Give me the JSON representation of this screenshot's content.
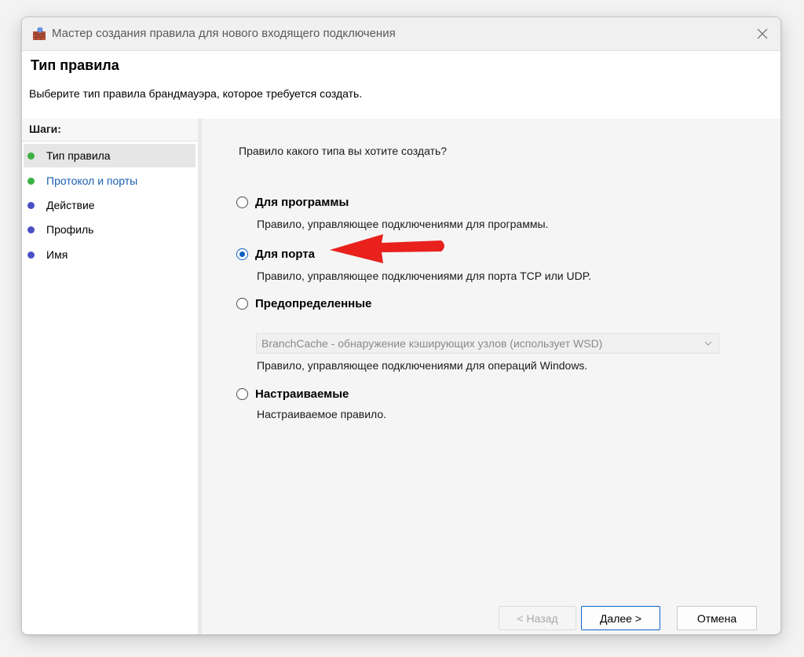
{
  "window": {
    "title": "Мастер создания правила для нового входящего подключения",
    "icon": "firewall-icon"
  },
  "header": {
    "title": "Тип правила",
    "description": "Выберите тип правила брандмауэра, которое требуется создать."
  },
  "steps": {
    "heading": "Шаги:",
    "items": [
      {
        "label": "Тип правила",
        "dot_color": "#3cb043",
        "active": true
      },
      {
        "label": "Протокол и порты",
        "dot_color": "#3cb043",
        "link": true
      },
      {
        "label": "Действие",
        "dot_color": "#4a4fc4"
      },
      {
        "label": "Профиль",
        "dot_color": "#4a4fc4"
      },
      {
        "label": "Имя",
        "dot_color": "#4a4fc4"
      }
    ]
  },
  "content": {
    "question": "Правило какого типа вы хотите создать?",
    "options": [
      {
        "label": "Для программы",
        "description": "Правило, управляющее подключениями для программы.",
        "checked": false
      },
      {
        "label": "Для порта",
        "description": "Правило, управляющее подключениями для порта TCP или UDP.",
        "checked": true
      },
      {
        "label": "Предопределенные",
        "description": "Правило, управляющее подключениями для операций Windows.",
        "checked": false
      },
      {
        "label": "Настраиваемые",
        "description": "Настраиваемое правило.",
        "checked": false
      }
    ],
    "predefined_select": {
      "value": "BranchCache - обнаружение кэширующих узлов (использует WSD)"
    }
  },
  "buttons": {
    "back": "< Назад",
    "next": "Далее >",
    "cancel": "Отмена"
  },
  "annotation": {
    "arrow_color": "#e8211d"
  }
}
